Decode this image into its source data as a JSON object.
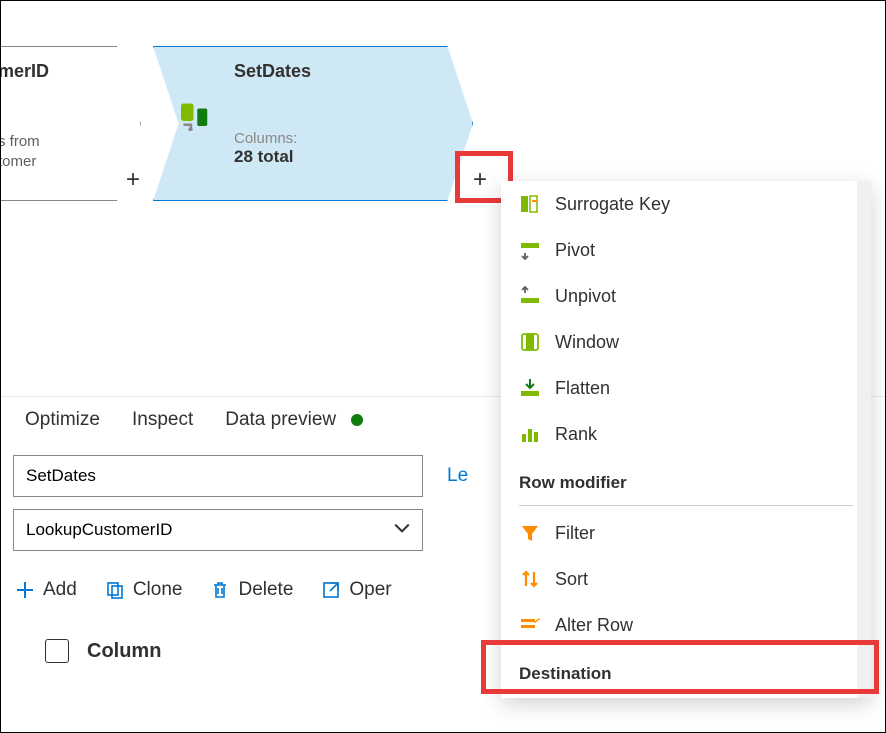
{
  "canvas": {
    "node_left": {
      "title_fragment": "merID",
      "desc_line1": "s from",
      "desc_line2": "tomer"
    },
    "node_right": {
      "title": "SetDates",
      "columns_label": "Columns:",
      "columns_value": "28 total"
    }
  },
  "panel": {
    "tabs": {
      "optimize": "Optimize",
      "inspect": "Inspect",
      "preview": "Data preview"
    },
    "name_input_value": "SetDates",
    "learn_link": "Le",
    "incoming_value": "LookupCustomerID",
    "toolbar": {
      "add": "Add",
      "clone": "Clone",
      "delete": "Delete",
      "open": "Oper"
    },
    "column_header": "Column"
  },
  "menu": {
    "items_top": [
      {
        "label": "Surrogate Key",
        "icon": "surrogate"
      },
      {
        "label": "Pivot",
        "icon": "pivot"
      },
      {
        "label": "Unpivot",
        "icon": "unpivot"
      },
      {
        "label": "Window",
        "icon": "window"
      },
      {
        "label": "Flatten",
        "icon": "flatten"
      },
      {
        "label": "Rank",
        "icon": "rank"
      }
    ],
    "section_row_modifier": "Row modifier",
    "items_row": [
      {
        "label": "Filter",
        "icon": "filter"
      },
      {
        "label": "Sort",
        "icon": "sort"
      },
      {
        "label": "Alter Row",
        "icon": "alter"
      }
    ],
    "section_destination": "Destination"
  }
}
